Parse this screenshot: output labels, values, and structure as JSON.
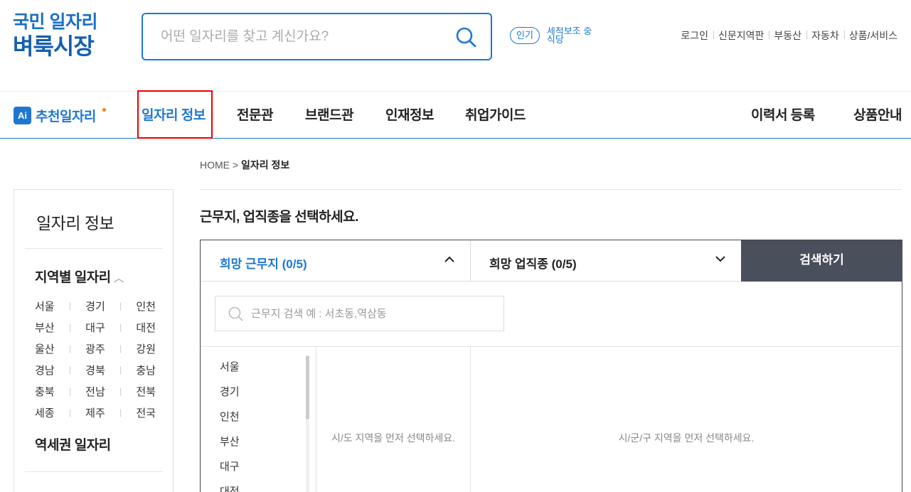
{
  "logo": {
    "line1": "국민 일자리",
    "line2": "벼룩시장"
  },
  "search": {
    "placeholder": "어떤 일자리를 찾고 계신가요?"
  },
  "popular": {
    "badge": "인기",
    "keyword": "세척보조 중식당"
  },
  "util_links": [
    "로그인",
    "신문지역판",
    "부동산",
    "자동차",
    "상품/서비스"
  ],
  "gnb": {
    "ai_badge": "Ai",
    "ai_label": "추천일자리",
    "items": [
      "일자리 정보",
      "전문관",
      "브랜드관",
      "인재정보",
      "취업가이드"
    ],
    "right_items": [
      "이력서 등록",
      "상품안내"
    ]
  },
  "breadcrumb": {
    "home": "HOME",
    "sep": ">",
    "current": "일자리 정보"
  },
  "sidebar": {
    "title": "일자리 정보",
    "section1": "지역별 일자리",
    "regions": [
      [
        "서울",
        "경기",
        "인천"
      ],
      [
        "부산",
        "대구",
        "대전"
      ],
      [
        "울산",
        "광주",
        "강원"
      ],
      [
        "경남",
        "경북",
        "충남"
      ],
      [
        "충북",
        "전남",
        "전북"
      ],
      [
        "세종",
        "제주",
        "전국"
      ]
    ],
    "section2": "역세권 일자리"
  },
  "main": {
    "title": "근무지, 업직종을 선택하세요.",
    "tab_location": "희망 근무지 (0/5)",
    "tab_job": "희망 업직종 (0/5)",
    "search_button": "검색하기",
    "loc_search_placeholder": "근무지 검색 예 : 서초동,역삼동",
    "city_list": [
      "서울",
      "경기",
      "인천",
      "부산",
      "대구",
      "대전"
    ],
    "pane2_msg": "시/도 지역을 먼저 선택하세요.",
    "pane3_msg": "시/군/구 지역을 먼저 선택하세요."
  },
  "colors": {
    "brand": "#1e78d1",
    "highlight": "#ee0000",
    "button_dark": "#4a4f5c"
  }
}
